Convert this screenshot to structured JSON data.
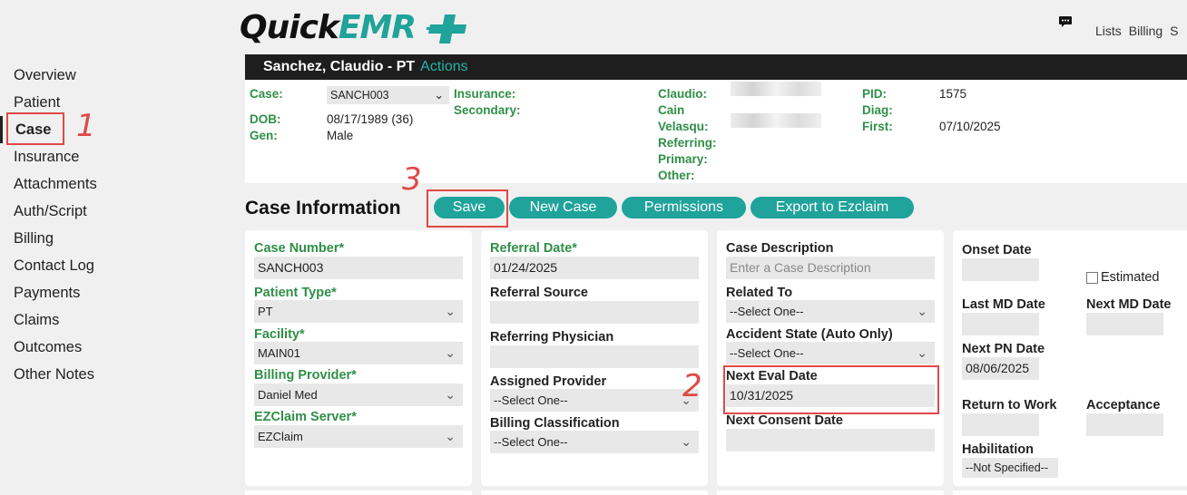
{
  "header": {
    "logo_main": "Quick",
    "logo_accent": "EMR",
    "nav": [
      "Lists",
      "Billing",
      "S"
    ]
  },
  "colors": {
    "accent": "#1fa39a",
    "label_green": "#2f8f47",
    "annotation_red": "#e04848"
  },
  "sidebar": {
    "items": [
      {
        "label": "Overview"
      },
      {
        "label": "Patient"
      },
      {
        "label": "Case"
      },
      {
        "label": "Insurance"
      },
      {
        "label": "Attachments"
      },
      {
        "label": "Auth/Script"
      },
      {
        "label": "Billing"
      },
      {
        "label": "Contact Log"
      },
      {
        "label": "Payments"
      },
      {
        "label": "Claims"
      },
      {
        "label": "Outcomes"
      },
      {
        "label": "Other Notes"
      }
    ],
    "active": "Case"
  },
  "patient_bar": {
    "name": "Sanchez, Claudio - PT",
    "actions": "Actions"
  },
  "patient_info": {
    "case_label": "Case:",
    "case_value": "SANCH003",
    "dob_label": "DOB:",
    "dob_value": "08/17/1989 (36)",
    "gen_label": "Gen:",
    "gen_value": "Male",
    "insurance_label": "Insurance:",
    "secondary_label": "Secondary:",
    "claudio_label": "Claudio:",
    "cain_label": "Cain",
    "velasqu_label": "Velasqu:",
    "referring_label": "Referring:",
    "primary_label": "Primary:",
    "other_label": "Other:",
    "pid_label": "PID:",
    "pid_value": "1575",
    "diag_label": "Diag:",
    "first_label": "First:",
    "first_value": "07/10/2025"
  },
  "section": {
    "title": "Case Information",
    "buttons": {
      "save": "Save",
      "new_case": "New Case",
      "permissions": "Permissions",
      "export": "Export to Ezclaim"
    }
  },
  "card1": {
    "case_number_label": "Case Number*",
    "case_number": "SANCH003",
    "patient_type_label": "Patient Type*",
    "patient_type": "PT",
    "facility_label": "Facility*",
    "facility": "MAIN01",
    "billing_provider_label": "Billing Provider*",
    "billing_provider": "Daniel Med",
    "ezclaim_label": "EZClaim Server*",
    "ezclaim": "EZClaim"
  },
  "card2": {
    "referral_date_label": "Referral Date*",
    "referral_date": "01/24/2025",
    "referral_source_label": "Referral Source",
    "referring_physician_label": "Referring Physician",
    "assigned_provider_label": "Assigned Provider",
    "assigned_provider": "--Select One--",
    "billing_class_label": "Billing Classification",
    "billing_class": "--Select One--"
  },
  "card3": {
    "case_desc_label": "Case Description",
    "case_desc_placeholder": "Enter a Case Description",
    "related_to_label": "Related To",
    "related_to": "--Select One--",
    "accident_label": "Accident State (Auto Only)",
    "accident": "--Select One--",
    "next_eval_label": "Next Eval Date",
    "next_eval": "10/31/2025",
    "next_consent_label": "Next Consent Date"
  },
  "card4": {
    "onset_label": "Onset Date",
    "estimated_label": "Estimated",
    "last_md_label": "Last MD Date",
    "next_md_label": "Next MD Date",
    "next_pn_label": "Next PN Date",
    "next_pn": "08/06/2025",
    "return_label": "Return to Work",
    "acceptance_label": "Acceptance",
    "habilitation_label": "Habilitation",
    "habilitation": "--Not Specified--"
  },
  "annotations": [
    "1",
    "2",
    "3"
  ]
}
